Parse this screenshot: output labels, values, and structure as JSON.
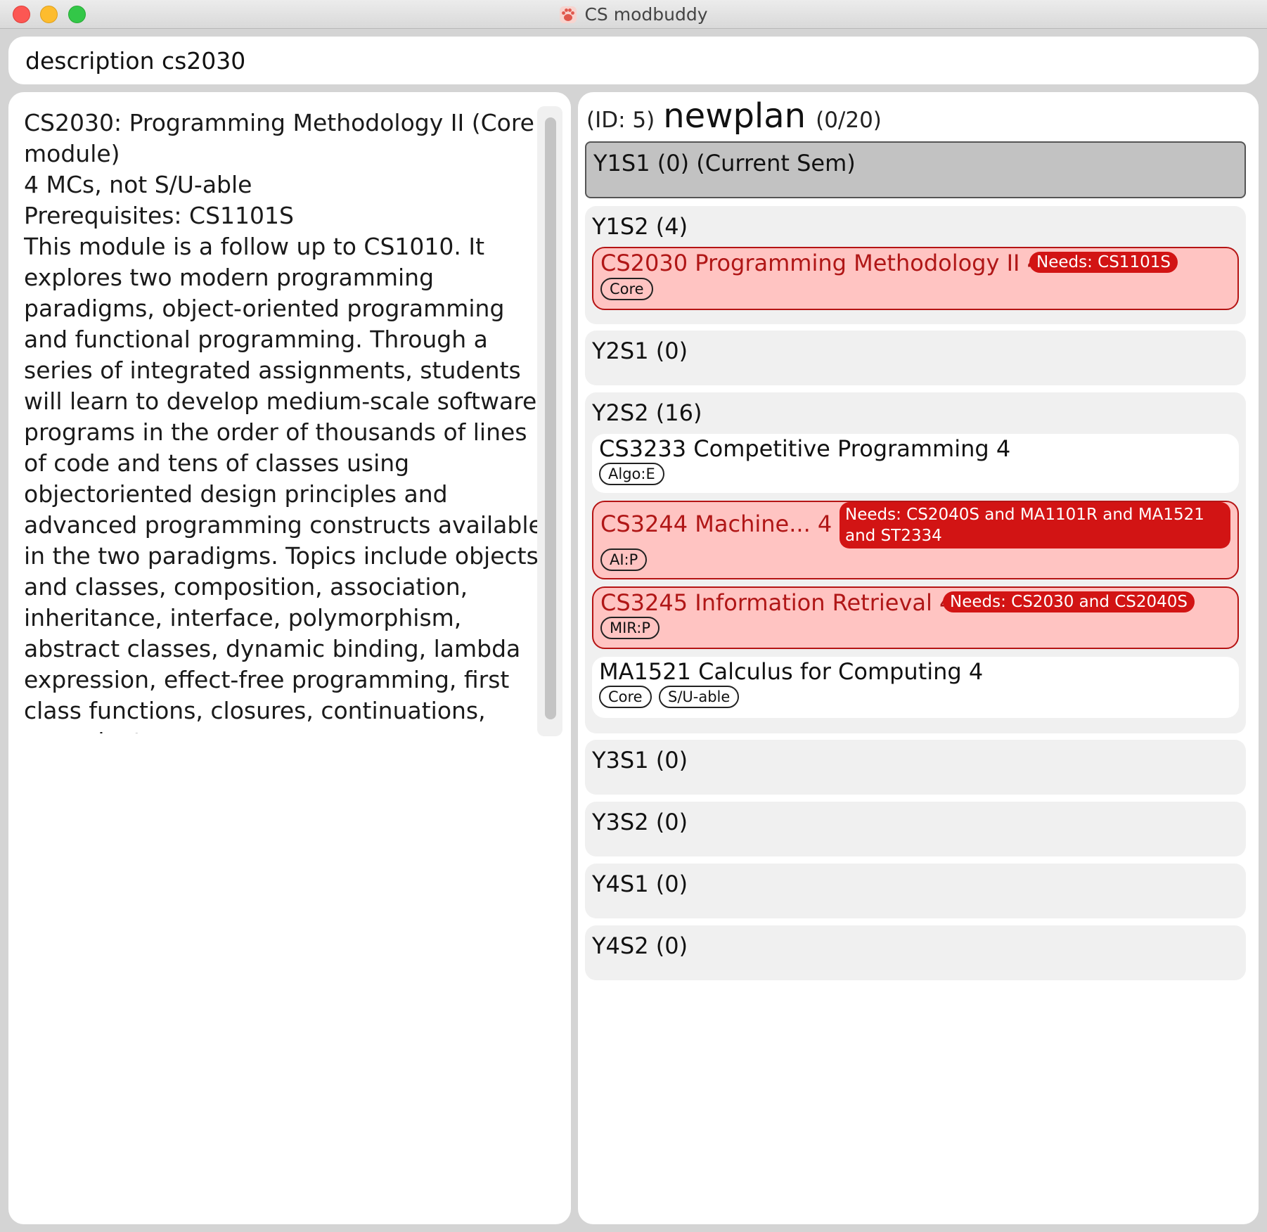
{
  "window": {
    "title": "CS modbuddy",
    "icon": "paw-icon"
  },
  "command": {
    "value": "description cs2030"
  },
  "description": {
    "lines": [
      "CS2030: Programming Methodology II (Core module)",
      "4 MCs, not S/U-able",
      "Prerequisites: CS1101S",
      "This module is a follow up to CS1010. It explores two modern programming paradigms, object-oriented programming and functional programming. Through a series of integrated assignments, students will learn to develop medium-scale software programs in the order of thousands of lines of code and tens of classes using objectoriented design principles and advanced programming constructs available in the two paradigms. Topics include objects and classes, composition, association, inheritance, interface, polymorphism, abstract classes, dynamic binding, lambda expression, effect-free programming, first class functions, closures, continuations, monad, etc."
    ]
  },
  "plan": {
    "id_label": "(ID: 5)",
    "name": "newplan",
    "count": "(0/20)",
    "semesters": [
      {
        "title": "Y1S1 (0)",
        "note": "(Current Sem)",
        "modules": []
      },
      {
        "title": "Y1S2 (4)",
        "modules": [
          {
            "title": "CS2030 Programming Methodology II 4",
            "needs": "Needs: CS1101S",
            "tags": [
              "Core"
            ],
            "warning": true
          }
        ]
      },
      {
        "title": "Y2S1 (0)",
        "modules": []
      },
      {
        "title": "Y2S2 (16)",
        "modules": [
          {
            "title": "CS3233 Competitive Programming 4",
            "needs": "",
            "tags": [
              "Algo:E"
            ],
            "warning": false
          },
          {
            "title": "CS3244 Machine...  4",
            "needs": "Needs: CS2040S and MA1101R and MA1521 and ST2334",
            "tags": [
              "AI:P"
            ],
            "warning": true
          },
          {
            "title": "CS3245 Information Retrieval 4",
            "needs": "Needs: CS2030 and CS2040S",
            "tags": [
              "MIR:P"
            ],
            "warning": true
          },
          {
            "title": "MA1521 Calculus for Computing 4",
            "needs": "",
            "tags": [
              "Core",
              "S/U-able"
            ],
            "warning": false
          }
        ]
      },
      {
        "title": "Y3S1 (0)",
        "modules": []
      },
      {
        "title": "Y3S2 (0)",
        "modules": []
      },
      {
        "title": "Y4S1 (0)",
        "modules": []
      },
      {
        "title": "Y4S2 (0)",
        "modules": []
      }
    ]
  },
  "colors": {
    "warning_bg": "#ffc4c2",
    "warning_border": "#b51414",
    "needs_badge": "#d21414",
    "semester_bg": "#f0f0f0",
    "current_sem_bg": "#c2c2c2"
  }
}
